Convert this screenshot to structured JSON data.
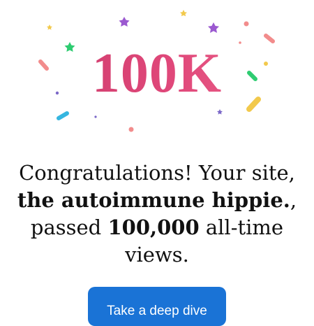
{
  "milestone": {
    "label": "100K",
    "color": "#d6336c"
  },
  "message": {
    "part1": "Congratulations! Your site, ",
    "site_name": "the autoimmune hippie.",
    "part2": ", passed ",
    "views": "100,000",
    "part3": " all-time views."
  },
  "cta": {
    "label": "Take a deep dive",
    "color": "#1a73d6"
  },
  "confetti_colors": [
    "#f2c94c",
    "#9b59d0",
    "#f28c8c",
    "#2ecc71",
    "#36b6e0",
    "#7b68c8"
  ]
}
